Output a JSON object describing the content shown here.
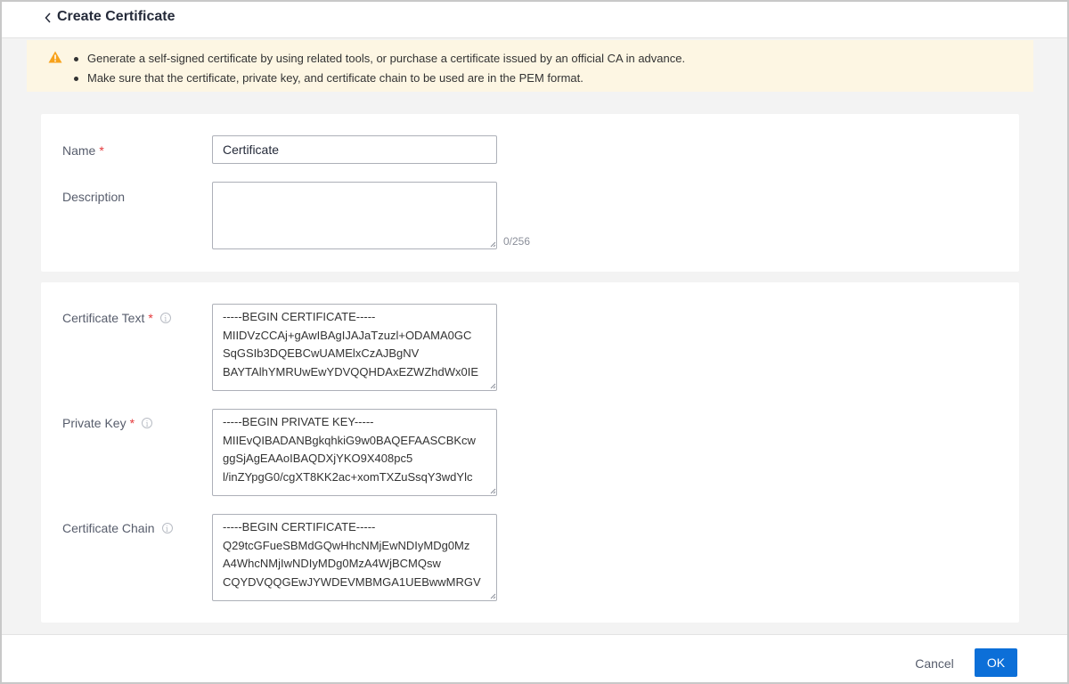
{
  "header": {
    "title": "Create Certificate",
    "back_icon": "chevron-left-icon"
  },
  "notice": {
    "icon": "warning-icon",
    "color": "#f7a21b",
    "background": "#fdf6e3",
    "items": [
      "Generate a self-signed certificate by using related tools, or purchase a certificate issued by an official CA in advance.",
      "Make sure that the certificate, private key, and certificate chain to be used are in the PEM format."
    ]
  },
  "form": {
    "required_mark": "*",
    "name": {
      "label": "Name",
      "value": "Certificate"
    },
    "description": {
      "label": "Description",
      "value": "",
      "counter": "0/256"
    },
    "certificate_text": {
      "label": "Certificate Text",
      "info_icon": "info-icon",
      "value": "-----BEGIN CERTIFICATE-----\nMIIDVzCCAj+gAwIBAgIJAJaTzuzl+ODAMA0GC\nSqGSIb3DQEBCwUAMElxCzAJBgNV\nBAYTAlhYMRUwEwYDVQQHDAxEZWZhdWx0IE"
    },
    "private_key": {
      "label": "Private Key",
      "info_icon": "info-icon",
      "value": "-----BEGIN PRIVATE KEY-----\nMIIEvQIBADANBgkqhkiG9w0BAQEFAASCBKcw\nggSjAgEAAoIBAQDXjYKO9X408pc5\nl/inZYpgG0/cgXT8KK2ac+xomTXZuSsqY3wdYlc"
    },
    "certificate_chain": {
      "label": "Certificate Chain",
      "info_icon": "info-icon",
      "value": "-----BEGIN CERTIFICATE-----\nQ29tcGFueSBMdGQwHhcNMjEwNDIyMDg0Mz\nA4WhcNMjIwNDIyMDg0MzA4WjBCMQsw\nCQYDVQQGEwJYWDEVMBMGA1UEBwwMRGV"
    }
  },
  "footer": {
    "cancel_label": "Cancel",
    "ok_label": "OK",
    "primary_color": "#0c6fd8"
  }
}
